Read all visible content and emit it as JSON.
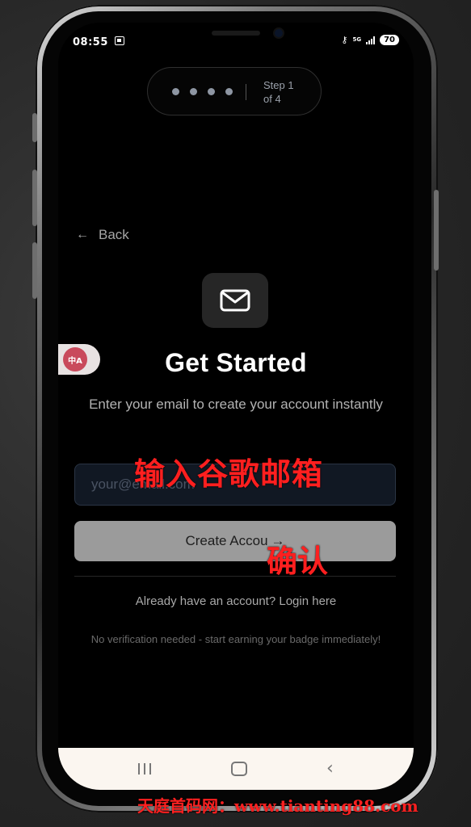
{
  "status_bar": {
    "time": "08:55",
    "network": "5G",
    "battery": "70"
  },
  "stepper": {
    "line1": "Step 1",
    "line2": "of 4"
  },
  "back": {
    "arrow": "←",
    "label": "Back"
  },
  "headline": "Get Started",
  "subtitle": "Enter your email to create your account instantly",
  "email_field": {
    "placeholder": "your@email.com",
    "value": ""
  },
  "create_button": {
    "label": "Create Accou",
    "arrow": "→"
  },
  "login_line": "Already have an account? Login here",
  "note_line": "No verification needed - start earning your badge immediately!",
  "overlay": {
    "line1": "输入谷歌邮箱",
    "line2": "确认"
  },
  "translate_bubble": "中A",
  "watermark": "天庭首码网：www.tianting88.com",
  "colors": {
    "screen_bg": "#000000",
    "button_bg": "#9b9b9b",
    "field_bg": "#111823",
    "overlay_red": "#ff1f1f",
    "nav_bg": "#fbf6f0"
  }
}
